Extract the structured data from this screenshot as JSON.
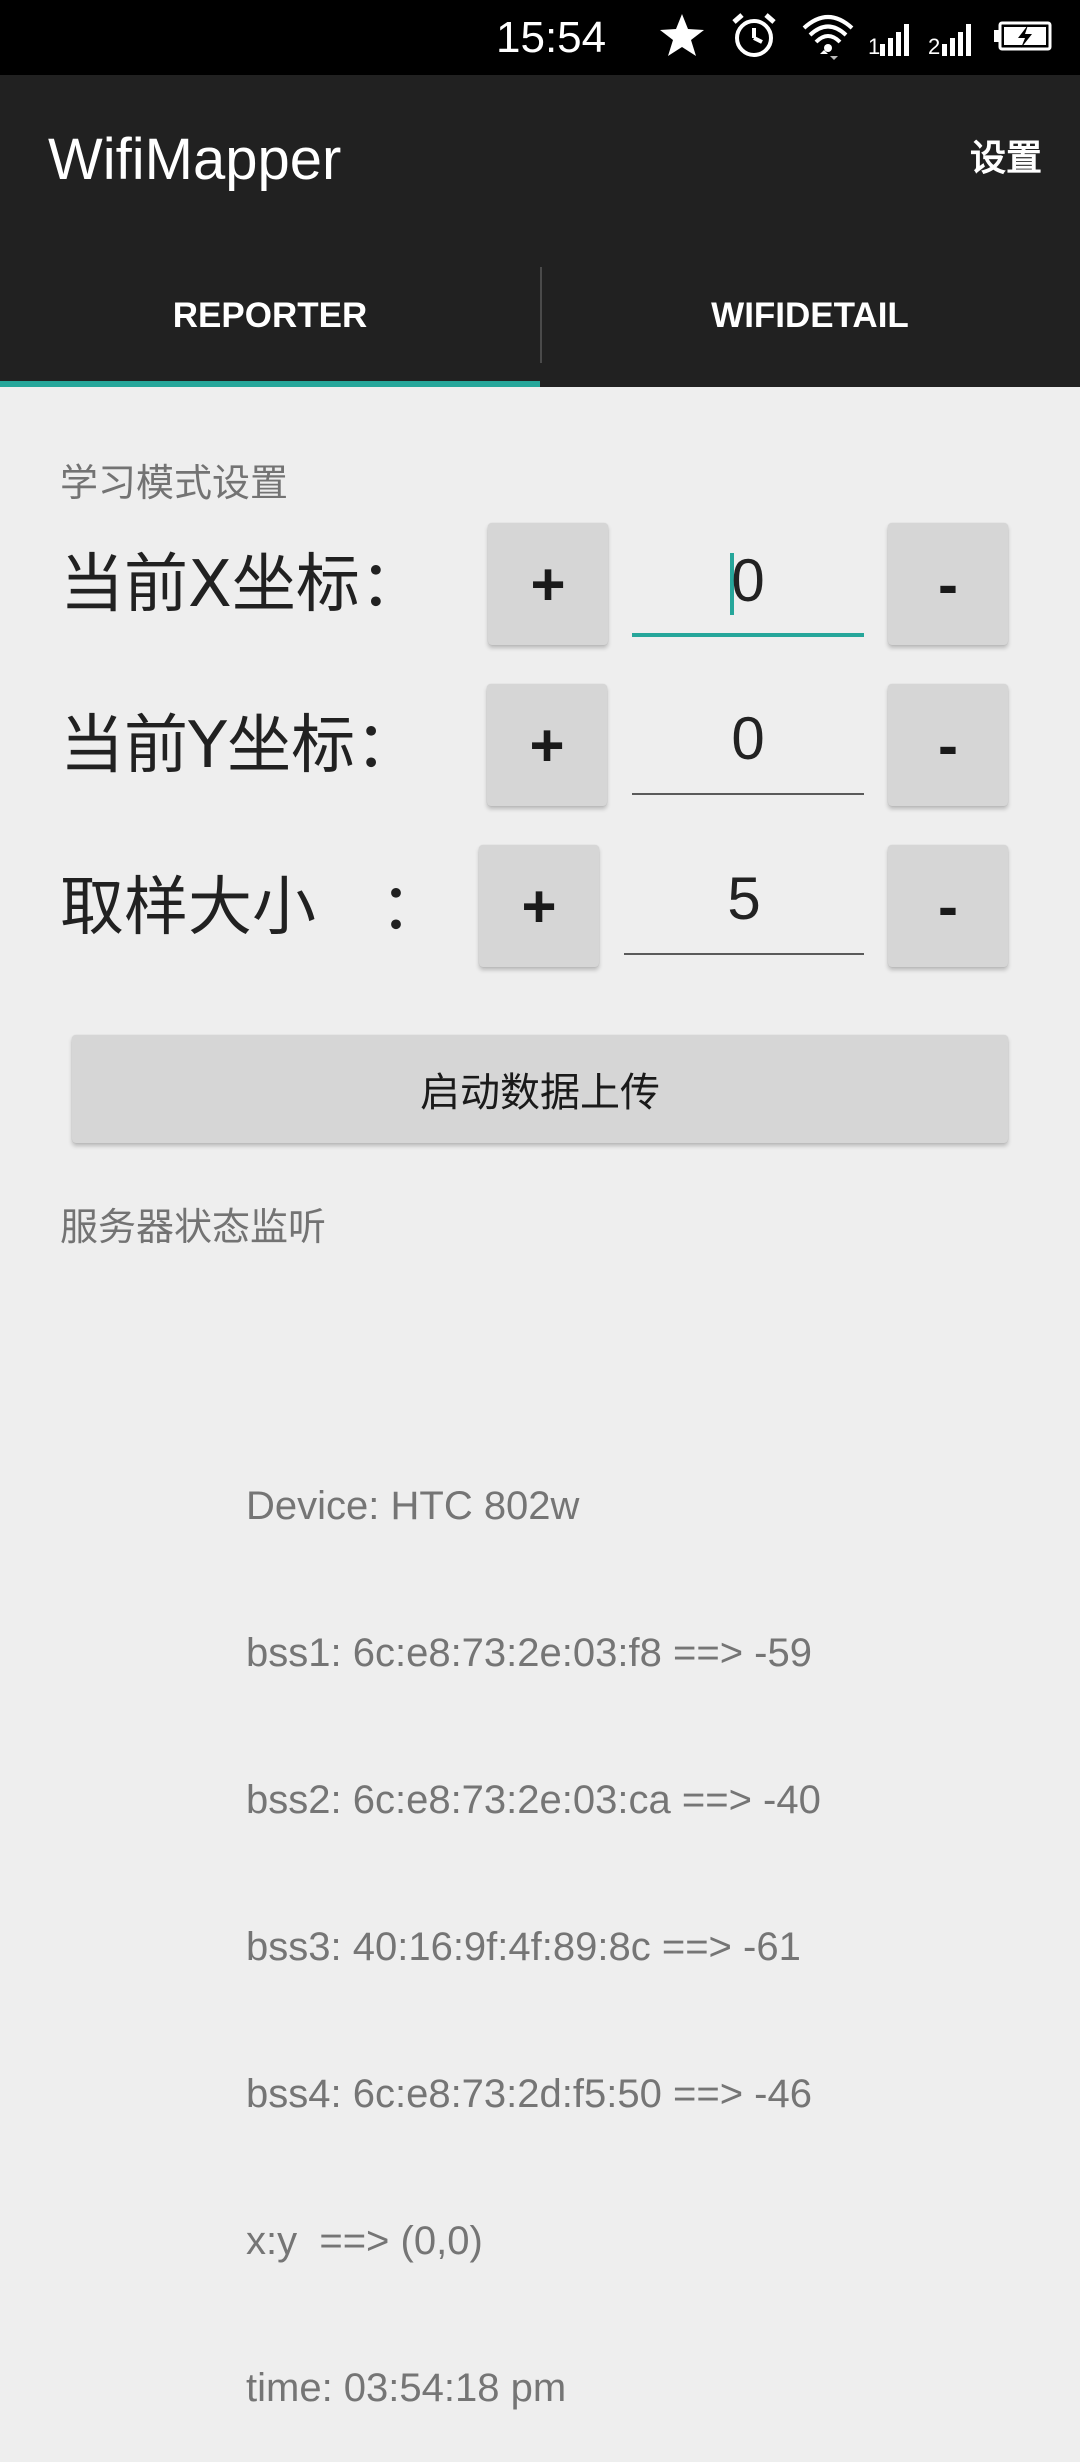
{
  "status_bar": {
    "time": "15:54",
    "icons": [
      "star-icon",
      "alarm-icon",
      "wifi-icon",
      "signal-1-icon",
      "signal-2-icon",
      "battery-charging-icon"
    ]
  },
  "app_bar": {
    "title": "WifiMapper",
    "settings_label": "设置"
  },
  "tabs": [
    {
      "label": "REPORTER",
      "selected": true
    },
    {
      "label": "WIFIDETAIL",
      "selected": false
    }
  ],
  "learning_section": {
    "title": "学习模式设置",
    "rows": [
      {
        "label": "当前X坐标：",
        "plus": "+",
        "value": "0",
        "minus": "-",
        "focused": true
      },
      {
        "label": "当前Y坐标：",
        "plus": "+",
        "value": "0",
        "minus": "-",
        "focused": false
      },
      {
        "label": "取样大小　：",
        "plus": "+",
        "value": "5",
        "minus": "-",
        "focused": false
      }
    ],
    "upload_button": "启动数据上传"
  },
  "monitor_section": {
    "title": "服务器状态监听",
    "lines": [
      "Device: HTC 802w",
      "bss1: 6c:e8:73:2e:03:f8 ==> -59",
      "bss2: 6c:e8:73:2e:03:ca ==> -40",
      "bss3: 40:16:9f:4f:89:8c ==> -61",
      "bss4: 6c:e8:73:2d:f5:50 ==> -46",
      "x:y  ==> (0,0)",
      "time: 03:54:18 pm"
    ]
  },
  "colors": {
    "accent": "#26a69a",
    "app_bar": "#212121",
    "background": "#eeeeee"
  }
}
